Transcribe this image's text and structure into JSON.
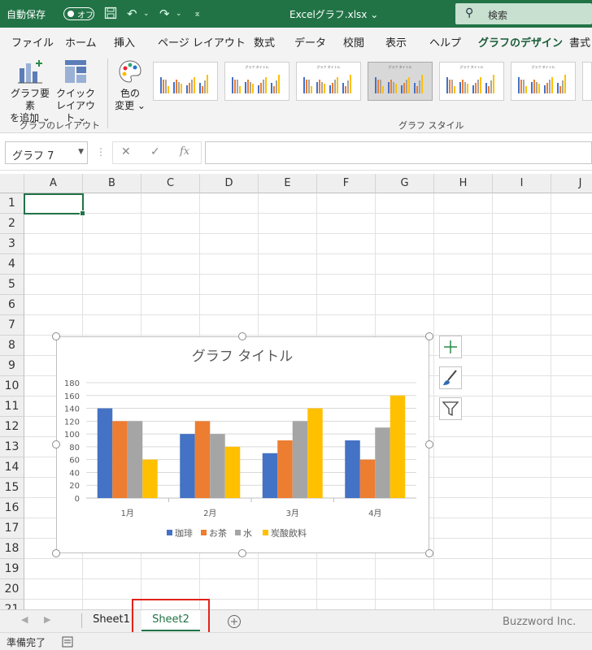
{
  "titlebar": {
    "autosave_label": "自動保存",
    "autosave_state": "オフ",
    "filename": "Excelグラフ.xlsx ⌄",
    "search_label": "検索"
  },
  "tabs": [
    "ファイル",
    "ホーム",
    "挿入",
    "ページ レイアウト",
    "数式",
    "データ",
    "校閲",
    "表示",
    "ヘルプ",
    "グラフのデザイン",
    "書式"
  ],
  "active_tab": "グラフのデザイン",
  "ribbon": {
    "add_element_l1": "グラフ要素",
    "add_element_l2": "を追加 ⌄",
    "quick_layout_l1": "クイック",
    "quick_layout_l2": "レイアウト ⌄",
    "change_color_l1": "色の",
    "change_color_l2": "変更 ⌄",
    "group_layout": "グラフのレイアウト",
    "group_style": "グラフ スタイル",
    "thumb_title": "グラフ タイトル"
  },
  "formula_bar": {
    "name_box": "グラフ 7",
    "fx": "fx",
    "cancel": "✕",
    "enter": "✓",
    "value": ""
  },
  "columns": [
    "A",
    "B",
    "C",
    "D",
    "E",
    "F",
    "G",
    "H",
    "I",
    "J"
  ],
  "rows": [
    "1",
    "2",
    "3",
    "4",
    "5",
    "6",
    "7",
    "8",
    "9",
    "10",
    "11",
    "12",
    "13",
    "14",
    "15",
    "16",
    "17",
    "18",
    "19",
    "20",
    "21"
  ],
  "chart_data": {
    "type": "bar",
    "title": "グラフ タイトル",
    "categories": [
      "1月",
      "2月",
      "3月",
      "4月"
    ],
    "series": [
      {
        "name": "珈琲",
        "color": "#4472C4",
        "values": [
          140,
          100,
          70,
          90
        ]
      },
      {
        "name": "お茶",
        "color": "#ED7D31",
        "values": [
          120,
          120,
          90,
          60
        ]
      },
      {
        "name": "水",
        "color": "#A5A5A5",
        "values": [
          120,
          100,
          120,
          110
        ]
      },
      {
        "name": "炭酸飲料",
        "color": "#FFC000",
        "values": [
          60,
          80,
          140,
          160
        ]
      }
    ],
    "yticks": [
      "0",
      "20",
      "40",
      "60",
      "80",
      "100",
      "120",
      "140",
      "160",
      "180"
    ],
    "ylim": [
      0,
      180
    ],
    "legend_position": "bottom",
    "grid": true
  },
  "sheets": [
    "Sheet1",
    "Sheet2"
  ],
  "active_sheet": "Sheet2",
  "status": {
    "ready": "準備完了",
    "watermark": "Buzzword Inc."
  }
}
